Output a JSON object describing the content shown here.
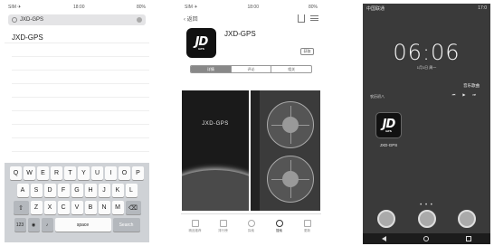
{
  "phone1": {
    "status": {
      "carrier": "SIM ✈",
      "time": "18:00",
      "battery": "80%"
    },
    "search_query": "JXD-GPS",
    "suggestion": "JXD-GPS",
    "keyboard": {
      "row1": [
        "Q",
        "W",
        "E",
        "R",
        "T",
        "Y",
        "U",
        "I",
        "O",
        "P"
      ],
      "row2": [
        "A",
        "S",
        "D",
        "F",
        "G",
        "H",
        "J",
        "K",
        "L"
      ],
      "row3": [
        "Z",
        "X",
        "C",
        "V",
        "B",
        "N",
        "M"
      ],
      "space_label": "space",
      "search_label": "Search",
      "numbers_label": "123"
    }
  },
  "phone2": {
    "status": {
      "carrier": "SIM ✈",
      "time": "18:00",
      "battery": "80%"
    },
    "back_label": "返回",
    "app_name": "JXD-GPS",
    "get_label": "获取",
    "segments": [
      "详情",
      "评论",
      "相关"
    ],
    "screenshot_title": "JXD-GPS",
    "tabs": [
      "精品推荐",
      "排行榜",
      "探索",
      "搜索",
      "更新"
    ]
  },
  "phone3": {
    "status": {
      "carrier": "中国联通",
      "time": "17:0"
    },
    "clock": "06:06",
    "date": "1月1日 周一",
    "music_title": "音乐歌曲",
    "side_info": "农历初八",
    "app_name": "JXD-GPS",
    "logo_text": "JD",
    "dots": "• • •"
  }
}
